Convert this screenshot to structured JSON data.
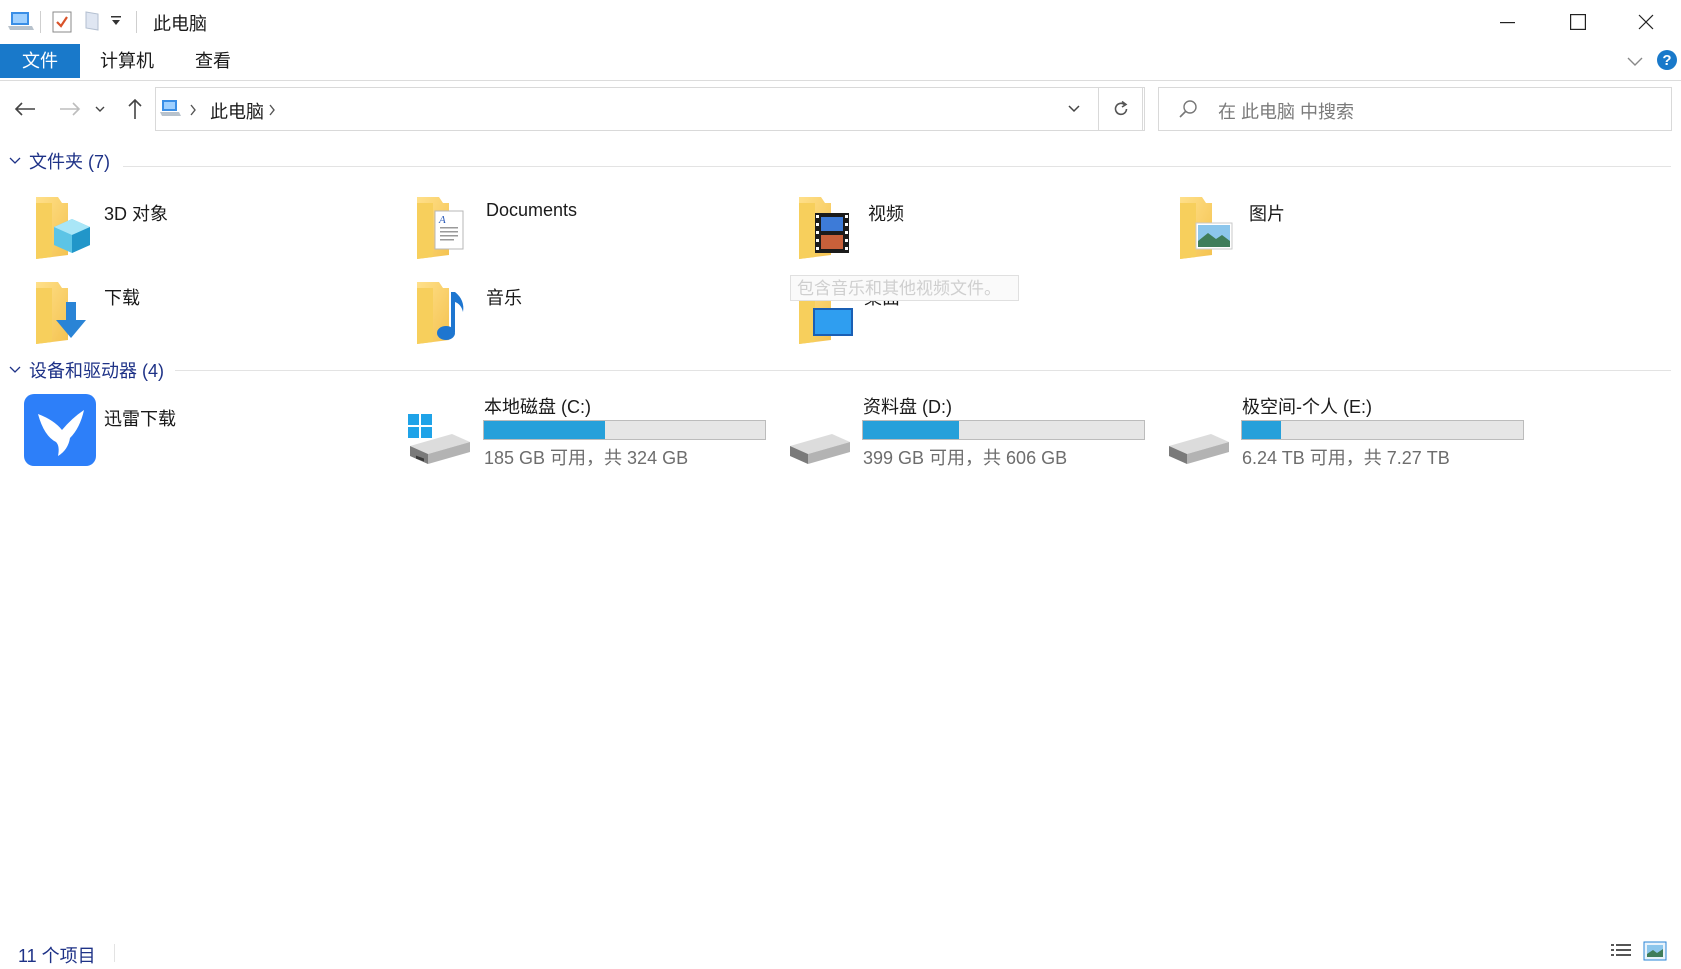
{
  "window": {
    "title": "此电脑",
    "controls": [
      "minimize-icon",
      "maximize-icon",
      "close-icon"
    ]
  },
  "ribbon": {
    "tabs": [
      {
        "label": "文件",
        "active": true
      },
      {
        "label": "计算机",
        "active": false
      },
      {
        "label": "查看",
        "active": false
      }
    ]
  },
  "address": {
    "crumbs": [
      "此电脑"
    ]
  },
  "search": {
    "placeholder": "在 此电脑 中搜索"
  },
  "folders": {
    "header": "文件夹 (7)",
    "items": [
      {
        "label": "3D 对象",
        "icon": "3d-objects-folder-icon"
      },
      {
        "label": "Documents",
        "icon": "documents-folder-icon"
      },
      {
        "label": "视频",
        "icon": "videos-folder-icon"
      },
      {
        "label": "图片",
        "icon": "pictures-folder-icon"
      },
      {
        "label": "下载",
        "icon": "downloads-folder-icon"
      },
      {
        "label": "音乐",
        "icon": "music-folder-icon"
      },
      {
        "label": "桌面",
        "icon": "desktop-folder-icon"
      }
    ],
    "tooltip": "包含音乐和其他视频文件。"
  },
  "devices": {
    "header": "设备和驱动器 (4)",
    "app": {
      "label": "迅雷下载",
      "icon": "xunlei-icon"
    },
    "drives": [
      {
        "name": "本地磁盘 (C:)",
        "space": "185 GB 可用，共 324 GB",
        "used_fraction": 0.43,
        "icon": "windows-drive-icon"
      },
      {
        "name": "资料盘 (D:)",
        "space": "399 GB 可用，共 606 GB",
        "used_fraction": 0.34,
        "icon": "drive-icon"
      },
      {
        "name": "极空间-个人 (E:)",
        "space": "6.24 TB 可用，共 7.27 TB",
        "used_fraction": 0.14,
        "icon": "drive-icon"
      }
    ]
  },
  "status": {
    "count": "11 个项目"
  },
  "colors": {
    "accent": "#1979ca",
    "bar_fill": "#26a0da",
    "group_header": "#1e3287"
  }
}
